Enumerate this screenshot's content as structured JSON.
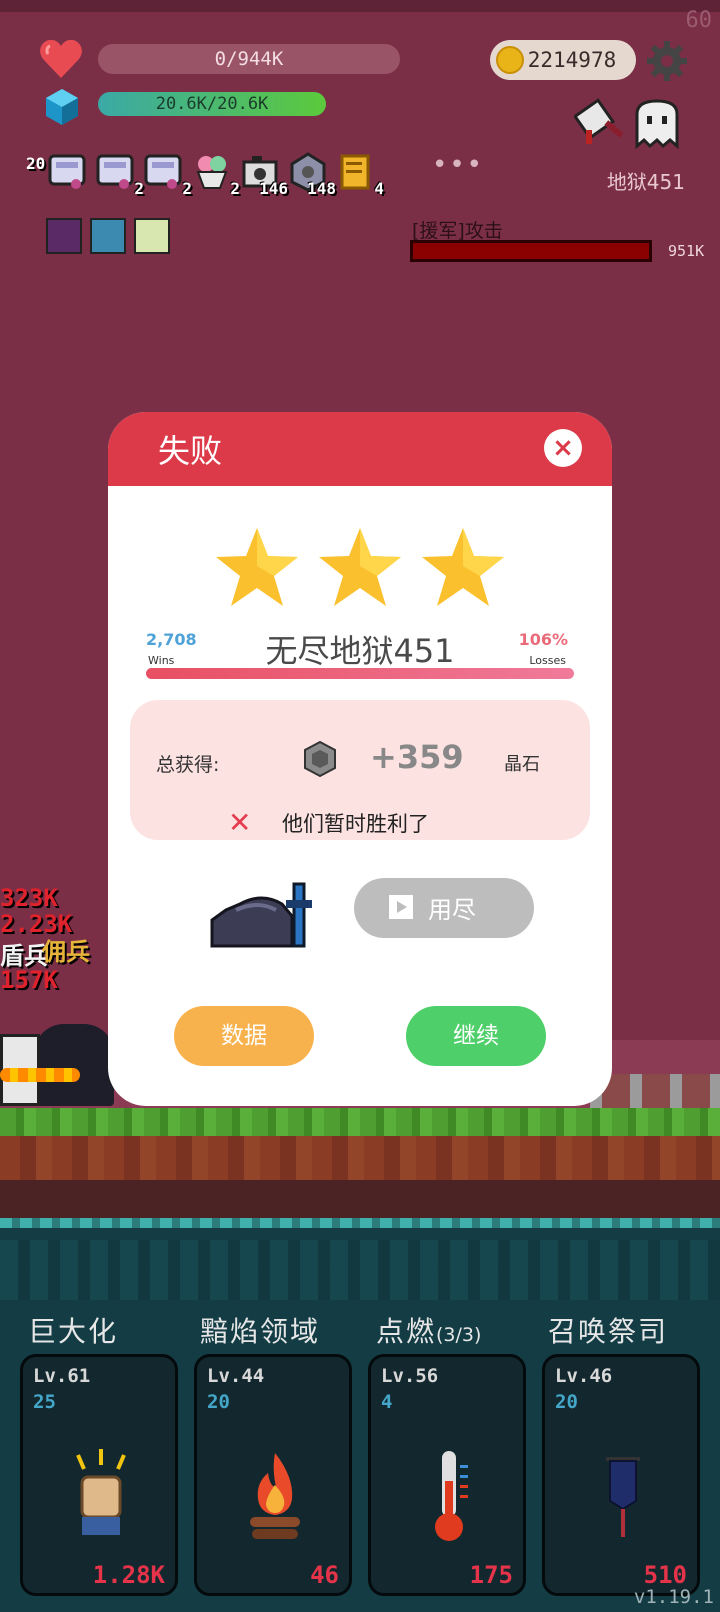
{
  "hud": {
    "fps": "60",
    "hp_text": "0/944K",
    "mp_text": "20.6K/20.6K",
    "coins": "2214978",
    "level_label": "地狱451",
    "inventory_left_count": "20",
    "inventory": [
      {
        "icon": "scroll-bag-icon",
        "count": ""
      },
      {
        "icon": "scroll-bag-icon",
        "count": "2"
      },
      {
        "icon": "scroll-bag-icon",
        "count": "2"
      },
      {
        "icon": "ice-cream-icon",
        "count": "2"
      },
      {
        "icon": "camera-icon",
        "count": "146"
      },
      {
        "icon": "gear-chip-icon",
        "count": "148"
      },
      {
        "icon": "scroll-icon",
        "count": "4"
      }
    ],
    "more": "•••",
    "ally_label": "[援军]攻击",
    "ally_value": "951K"
  },
  "damage_numbers": [
    "323K",
    "2.23K",
    "157K"
  ],
  "damage_labels": [
    "盾兵",
    "佣兵"
  ],
  "dialog": {
    "title": "失败",
    "close": "×",
    "wins_value": "2,708",
    "wins_label": "Wins",
    "losses_value": "106%",
    "losses_label": "Losses",
    "stage_name": "无尽地狱451",
    "reward_label": "总获得:",
    "reward_amount": "+359",
    "reward_unit": "晶石",
    "defeat_message": "他们暂时胜利了",
    "ad_button": "用尽",
    "stats_button": "数据",
    "continue_button": "继续"
  },
  "skills": [
    {
      "name": "巨大化",
      "suffix": "",
      "level": "Lv.61",
      "cost": "25",
      "value": "1.28K",
      "icon": "fist-icon"
    },
    {
      "name": "黯焰领域",
      "suffix": "",
      "level": "Lv.44",
      "cost": "20",
      "value": "46",
      "icon": "campfire-icon"
    },
    {
      "name": "点燃",
      "suffix": "(3/3)",
      "level": "Lv.56",
      "cost": "4",
      "value": "175",
      "icon": "thermometer-icon"
    },
    {
      "name": "召唤祭司",
      "suffix": "",
      "level": "Lv.46",
      "cost": "20",
      "value": "510",
      "icon": "banner-icon"
    }
  ],
  "version": "v1.19.1",
  "colors": {
    "background": "#7a2f47",
    "dialog_header": "#dc3a49",
    "stats_button": "#f7b24d",
    "continue_button": "#4fcf69",
    "skill_value": "#e5334a"
  }
}
